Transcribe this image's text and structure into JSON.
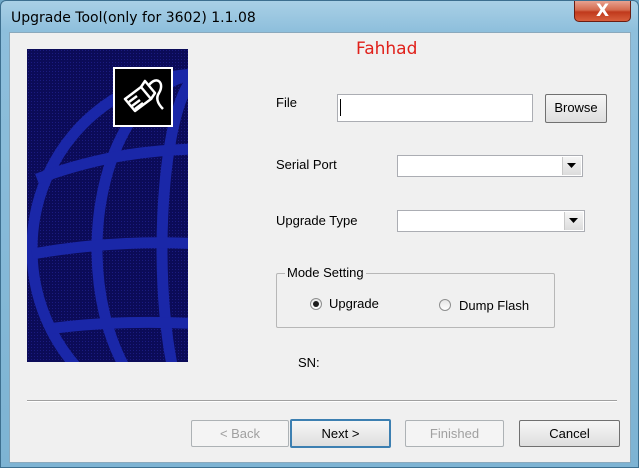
{
  "window": {
    "title": "Upgrade Tool(only for 3602) 1.1.08",
    "close_label": "X"
  },
  "brand": "Fahhad",
  "form": {
    "file_label": "File",
    "file_value": "",
    "browse_label": "Browse",
    "serial_port_label": "Serial Port",
    "serial_port_value": "",
    "upgrade_type_label": "Upgrade Type",
    "upgrade_type_value": "",
    "mode_group_title": "Mode Setting",
    "mode_options": [
      {
        "label": "Upgrade",
        "selected": true
      },
      {
        "label": "Dump Flash",
        "selected": false
      }
    ],
    "sn_label": "SN:"
  },
  "buttons": {
    "back": "< Back",
    "next": "Next >",
    "finished": "Finished",
    "cancel": "Cancel"
  },
  "icons": {
    "banner_logo": "network-cable-icon",
    "banner_art": "globe-grid"
  },
  "colors": {
    "banner_bg": "#0b0b58",
    "globe_lines": "#1a27a8",
    "brand_text": "#e0201a"
  }
}
